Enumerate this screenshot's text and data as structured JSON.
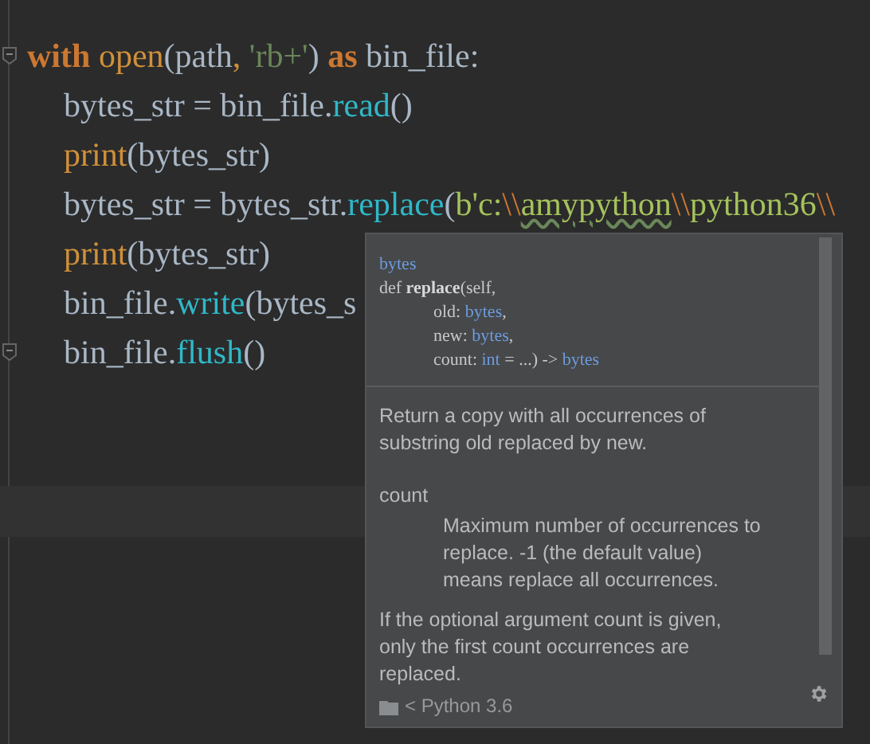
{
  "editor": {
    "lines": [
      {
        "indent": false,
        "fold": true,
        "tokens": [
          {
            "kind": "keyword",
            "text": "with"
          },
          {
            "kind": "builtin",
            "text": " open"
          },
          {
            "kind": "plain",
            "text": "(path"
          },
          {
            "kind": "builtin",
            "text": ", "
          },
          {
            "kind": "string",
            "text": "'rb+'"
          },
          {
            "kind": "plain",
            "text": ") "
          },
          {
            "kind": "keyword",
            "text": "as"
          },
          {
            "kind": "plain",
            "text": " bin_file:"
          }
        ]
      },
      {
        "indent": true,
        "fold": false,
        "tokens": [
          {
            "kind": "plain",
            "text": "bytes_str = bin_file."
          },
          {
            "kind": "method",
            "text": "read"
          },
          {
            "kind": "plain",
            "text": "()"
          }
        ]
      },
      {
        "indent": true,
        "fold": false,
        "tokens": [
          {
            "kind": "builtin",
            "text": "print"
          },
          {
            "kind": "plain",
            "text": "(bytes_str)"
          }
        ]
      },
      {
        "indent": true,
        "fold": false,
        "tokens": [
          {
            "kind": "plain",
            "text": "bytes_str = bytes_str."
          },
          {
            "kind": "method",
            "text": "replace"
          },
          {
            "kind": "plain",
            "text": "("
          },
          {
            "kind": "bytes",
            "text": "b'c:"
          },
          {
            "kind": "escape",
            "text": "\\\\"
          },
          {
            "kind": "typo",
            "text": "amypython"
          },
          {
            "kind": "escape",
            "text": "\\\\"
          },
          {
            "kind": "bytes",
            "text": "python36"
          },
          {
            "kind": "escape",
            "text": "\\\\"
          }
        ]
      },
      {
        "indent": true,
        "fold": false,
        "tokens": [
          {
            "kind": "builtin",
            "text": "print"
          },
          {
            "kind": "plain",
            "text": "(bytes_str)"
          }
        ]
      },
      {
        "indent": true,
        "fold": false,
        "tokens": [
          {
            "kind": "plain",
            "text": "bin_file."
          },
          {
            "kind": "method",
            "text": "write"
          },
          {
            "kind": "plain",
            "text": "(bytes_s"
          }
        ]
      },
      {
        "indent": true,
        "fold": true,
        "tokens": [
          {
            "kind": "plain",
            "text": "bin_file."
          },
          {
            "kind": "method",
            "text": "flush"
          },
          {
            "kind": "plain",
            "text": "()"
          }
        ]
      }
    ]
  },
  "doc_popup": {
    "signature": [
      {
        "indent": false,
        "tokens": [
          {
            "kind": "type",
            "text": "bytes"
          }
        ]
      },
      {
        "indent": false,
        "tokens": [
          {
            "kind": "plain",
            "text": "def "
          },
          {
            "kind": "bold",
            "text": "replace"
          },
          {
            "kind": "plain",
            "text": "(self,"
          }
        ]
      },
      {
        "indent": true,
        "tokens": [
          {
            "kind": "plain",
            "text": "old: "
          },
          {
            "kind": "type",
            "text": "bytes"
          },
          {
            "kind": "plain",
            "text": ","
          }
        ]
      },
      {
        "indent": true,
        "tokens": [
          {
            "kind": "plain",
            "text": "new: "
          },
          {
            "kind": "type",
            "text": "bytes"
          },
          {
            "kind": "plain",
            "text": ","
          }
        ]
      },
      {
        "indent": true,
        "tokens": [
          {
            "kind": "plain",
            "text": "count: "
          },
          {
            "kind": "type",
            "text": "int"
          },
          {
            "kind": "plain",
            "text": " = ...) -> "
          },
          {
            "kind": "type",
            "text": "bytes"
          }
        ]
      }
    ],
    "summary": "Return a copy with all occurrences of substring old replaced by new.",
    "param_name": "count",
    "param_description": "Maximum number of occurrences to replace. -1 (the default value) means replace all occurrences.",
    "note": "If the optional argument count is given, only the first count occurrences are replaced.",
    "footer": "< Python 3.6"
  }
}
